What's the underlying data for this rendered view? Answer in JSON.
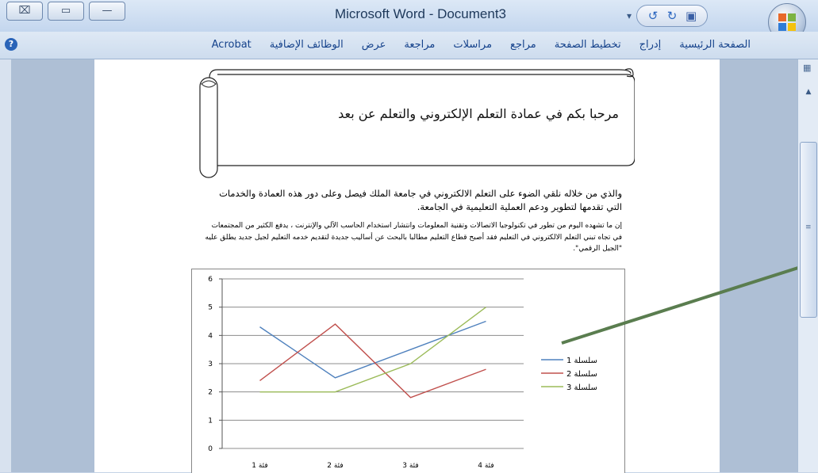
{
  "window": {
    "title": "Microsoft Word - Document3",
    "controls": [
      "⌧",
      "▭",
      "—"
    ]
  },
  "qat": {
    "dropdown": "▾",
    "undo": "↺",
    "redo": "↻",
    "save": "▣"
  },
  "tabs": [
    {
      "label": "الصفحة الرئيسية"
    },
    {
      "label": "إدراج"
    },
    {
      "label": "تخطيط الصفحة"
    },
    {
      "label": "مراجع"
    },
    {
      "label": "مراسلات"
    },
    {
      "label": "مراجعة"
    },
    {
      "label": "عرض"
    },
    {
      "label": "الوظائف الإضافية"
    },
    {
      "label": "Acrobat"
    }
  ],
  "help_glyph": "?",
  "document": {
    "banner_text": "مرحبا بكم في عمادة التعلم الإلكتروني والتعلم عن بعد",
    "paragraph1": "والذي من خلاله نلقي الضوء على التعلم الالكتروني في جامعة الملك فيصل وعلى دور هذه العمادة والخدمات التي تقدمها لتطوير ودعم العملية التعليمية في الجامعة.",
    "paragraph2": "إن ما تشهده اليوم من تطور في تكنولوجيا الاتصالات وتقنية المعلومات وانتشار استخدام الحاسب الآلي والإنترنت ، يدفع الكثير من المجتمعات في تجاه تبني التعلم الالكتروني في التعليم فقد أصبح قطاع التعليم مطالبا بالبحث عن أساليب جديدة لتقديم خدمه التعليم لجيل جديد يطلق عليه \"الجيل الرقمي\"."
  },
  "colors": {
    "arrow": "#5a7d4f",
    "series": [
      "#4f81bd",
      "#c0504d",
      "#9bbb59"
    ]
  },
  "chart_data": {
    "type": "line",
    "categories": [
      "فئة 1",
      "فئة 2",
      "فئة 3",
      "فئة 4"
    ],
    "series": [
      {
        "name": "سلسلة 1",
        "values": [
          4.3,
          2.5,
          3.5,
          4.5
        ]
      },
      {
        "name": "سلسلة 2",
        "values": [
          2.4,
          4.4,
          1.8,
          2.8
        ]
      },
      {
        "name": "سلسلة 3",
        "values": [
          2,
          2,
          3,
          5
        ]
      }
    ],
    "yticks": [
      "0",
      "1",
      "2",
      "3",
      "4",
      "5",
      "6"
    ],
    "ylim": [
      0,
      6
    ],
    "grid": true,
    "legend": "right"
  }
}
